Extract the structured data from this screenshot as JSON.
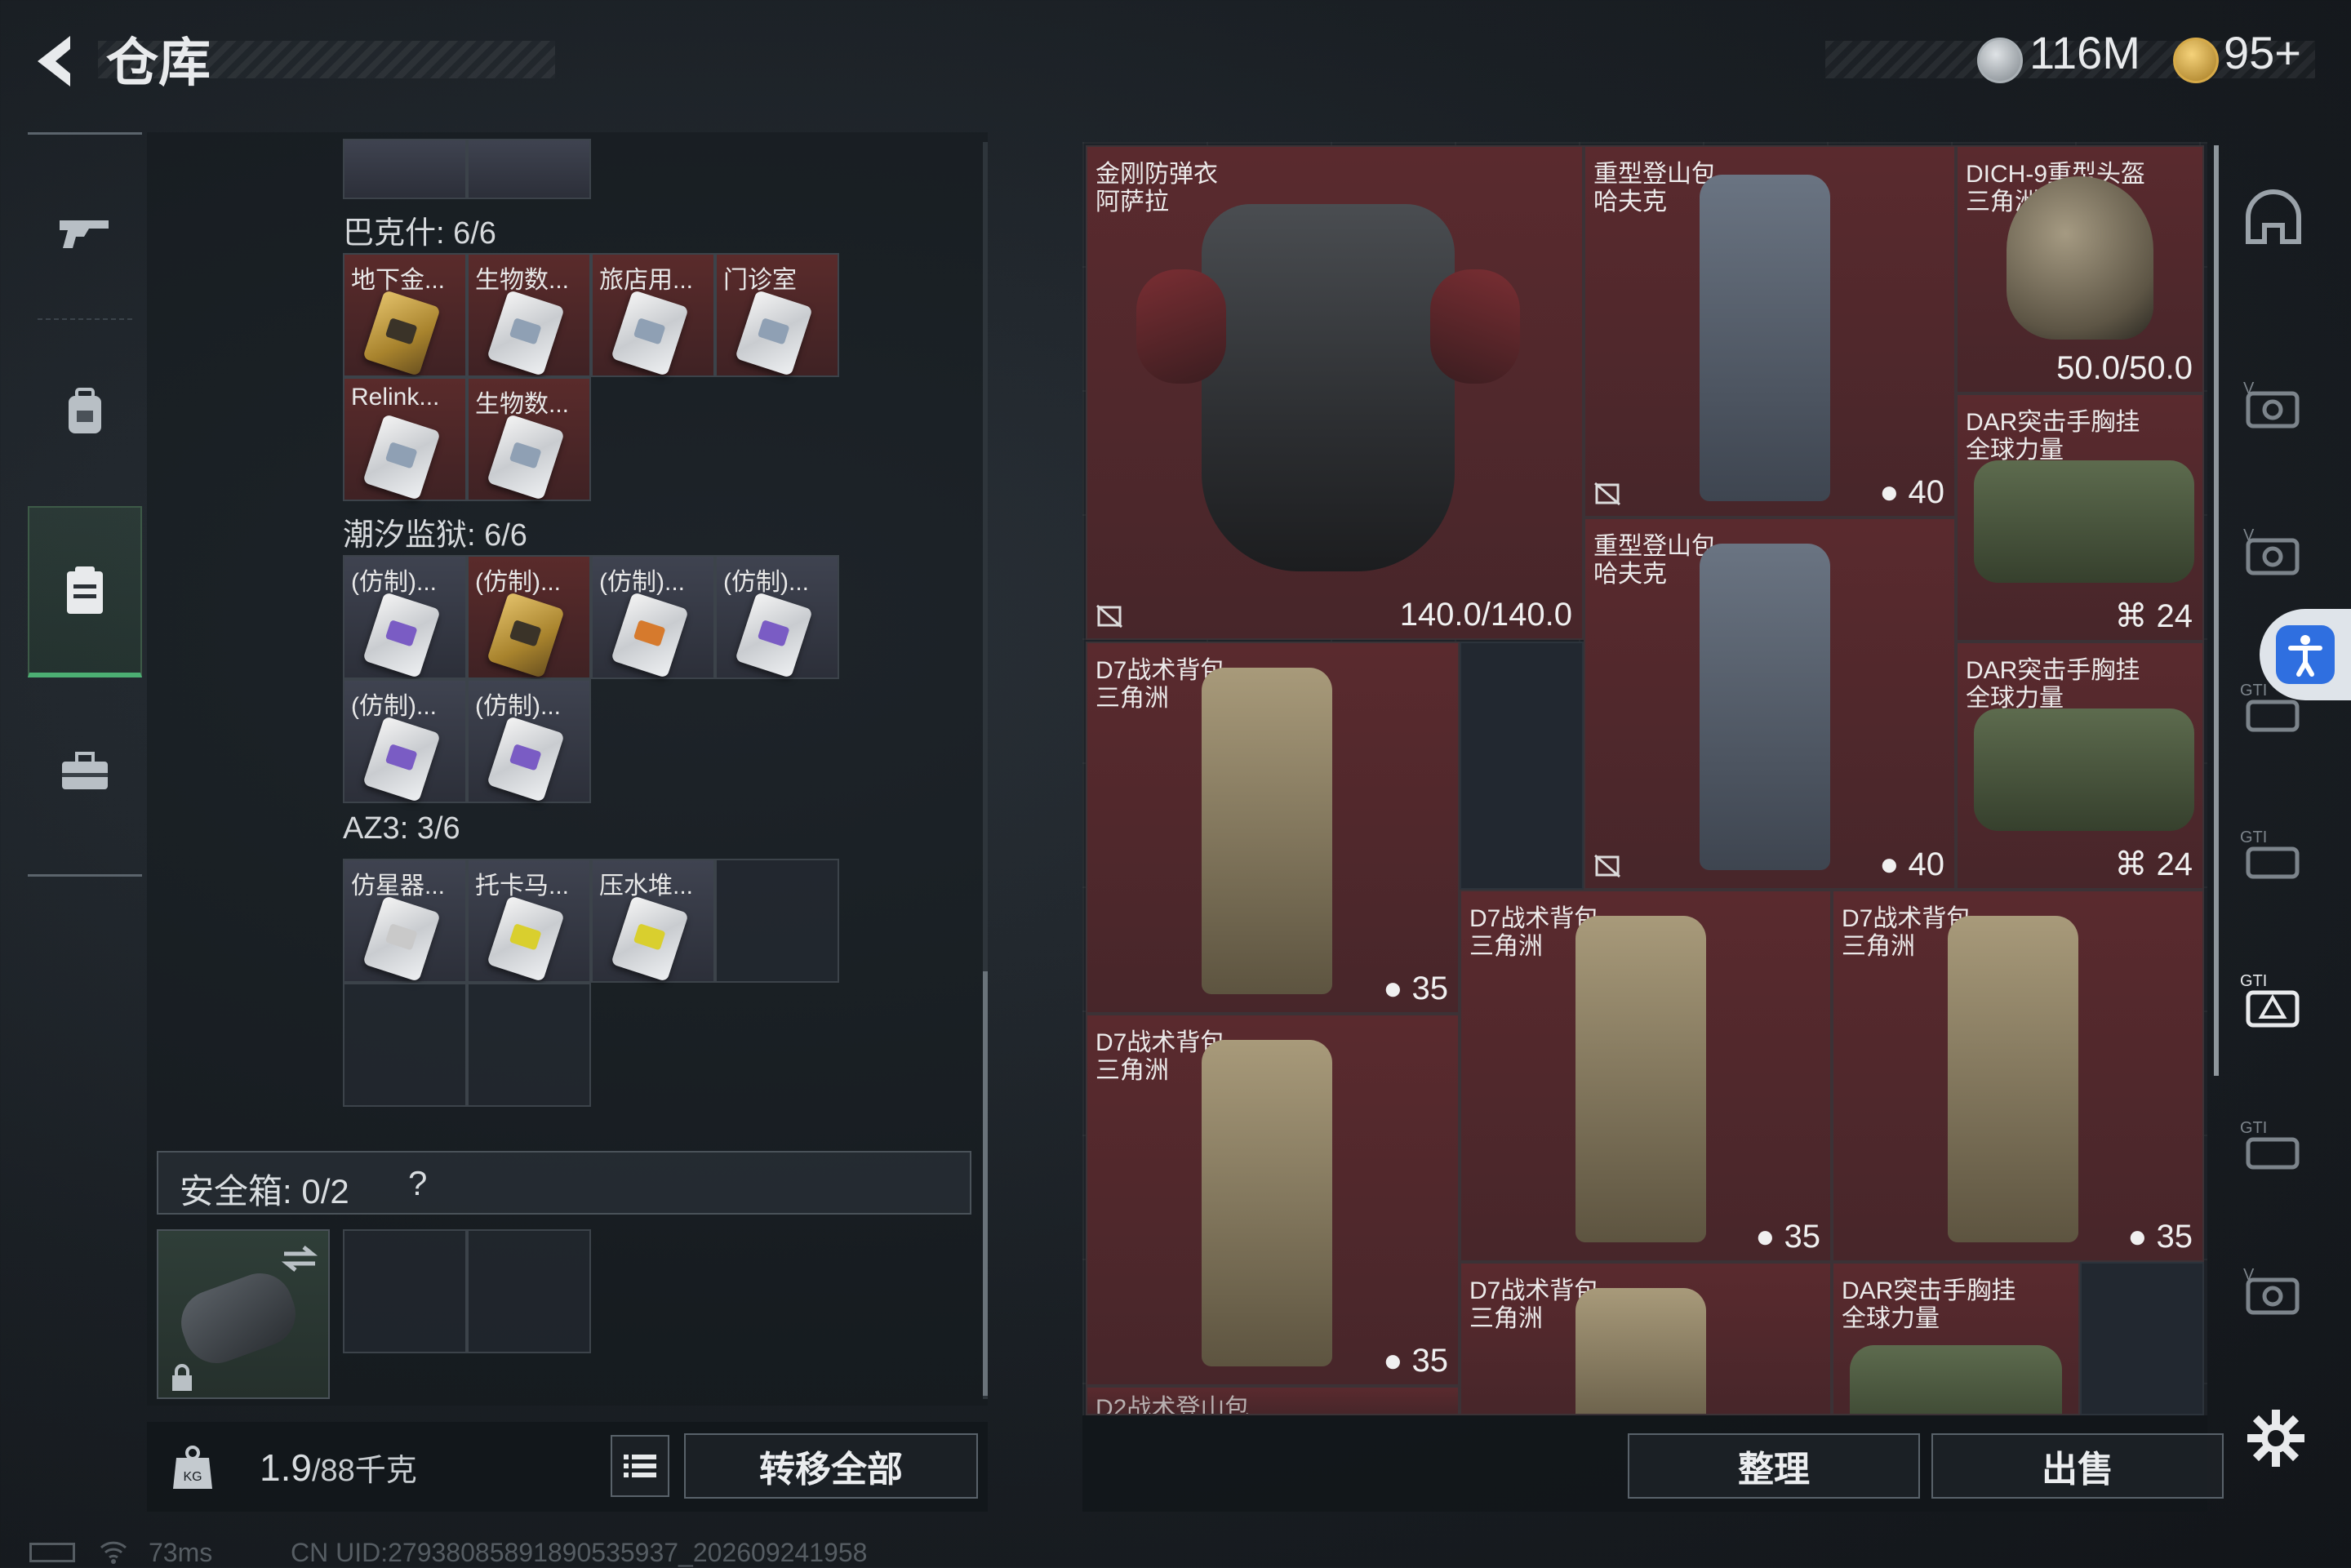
{
  "header": {
    "title": "仓库",
    "currency1": "116M",
    "currency2": "95+"
  },
  "left": {
    "sections": [
      {
        "label": "巴克什: 6/6",
        "items": [
          {
            "label": "地下金...",
            "card": "gold"
          },
          {
            "label": "生物数...",
            "card": "white"
          },
          {
            "label": "旅店用...",
            "card": "white"
          },
          {
            "label": "门诊室",
            "card": "white"
          },
          {
            "label": "Relink...",
            "card": "white"
          },
          {
            "label": "生物数...",
            "card": "white"
          }
        ]
      },
      {
        "label": "潮汐监狱: 6/6",
        "items": [
          {
            "label": "(仿制)...",
            "card": "purple"
          },
          {
            "label": "(仿制)...",
            "card": "gold"
          },
          {
            "label": "(仿制)...",
            "card": "orange"
          },
          {
            "label": "(仿制)...",
            "card": "purple"
          },
          {
            "label": "(仿制)...",
            "card": "purple"
          },
          {
            "label": "(仿制)...",
            "card": "purple"
          }
        ]
      },
      {
        "label": "AZ3: 3/6",
        "items": [
          {
            "label": "仿星器...",
            "card": "white2"
          },
          {
            "label": "托卡马...",
            "card": "yellow"
          },
          {
            "label": "压水堆...",
            "card": "yellow"
          }
        ]
      }
    ],
    "safe_box_label": "安全箱: 0/2",
    "safe_box_help": "?",
    "weight": "1.9",
    "weight_max": "/88千克",
    "transfer_all": "转移全部"
  },
  "right": {
    "items": [
      {
        "name": "金刚防弹衣",
        "sub": "阿萨拉",
        "cap": "140.0/140.0"
      },
      {
        "name": "重型登山包",
        "sub": "哈夫克",
        "cap": "40"
      },
      {
        "name": "DICH-9重型头盔",
        "sub": "三角洲",
        "cap": "50.0/50.0"
      },
      {
        "name": "DAR突击手胸挂",
        "sub": "全球力量",
        "cap": "24"
      },
      {
        "name": "重型登山包",
        "sub": "哈夫克",
        "cap": "40"
      },
      {
        "name": "D7战术背包",
        "sub": "三角洲",
        "cap": "35"
      },
      {
        "name": "DAR突击手胸挂",
        "sub": "全球力量",
        "cap": "24"
      },
      {
        "name": "D7战术背包",
        "sub": "三角洲",
        "cap": "35"
      },
      {
        "name": "D7战术背包",
        "sub": "三角洲",
        "cap": "35"
      },
      {
        "name": "D7战术背包",
        "sub": "三角洲",
        "cap": "35"
      },
      {
        "name": "D7战术背包",
        "sub": "三角洲",
        "cap": ""
      },
      {
        "name": "DAR突击手胸挂",
        "sub": "全球力量",
        "cap": ""
      },
      {
        "name": "D2战术登山包",
        "sub": "",
        "cap": ""
      }
    ],
    "sort_button": "整理",
    "sell_button": "出售"
  },
  "status": {
    "ping": "73ms",
    "uid": "CN UID:27938085891890535937_202609241958"
  },
  "colors": {
    "accent_green": "#4caf73",
    "item_red": "#5a2a2e",
    "item_blue": "#3f4350",
    "fab_blue": "#2f6fe0"
  }
}
